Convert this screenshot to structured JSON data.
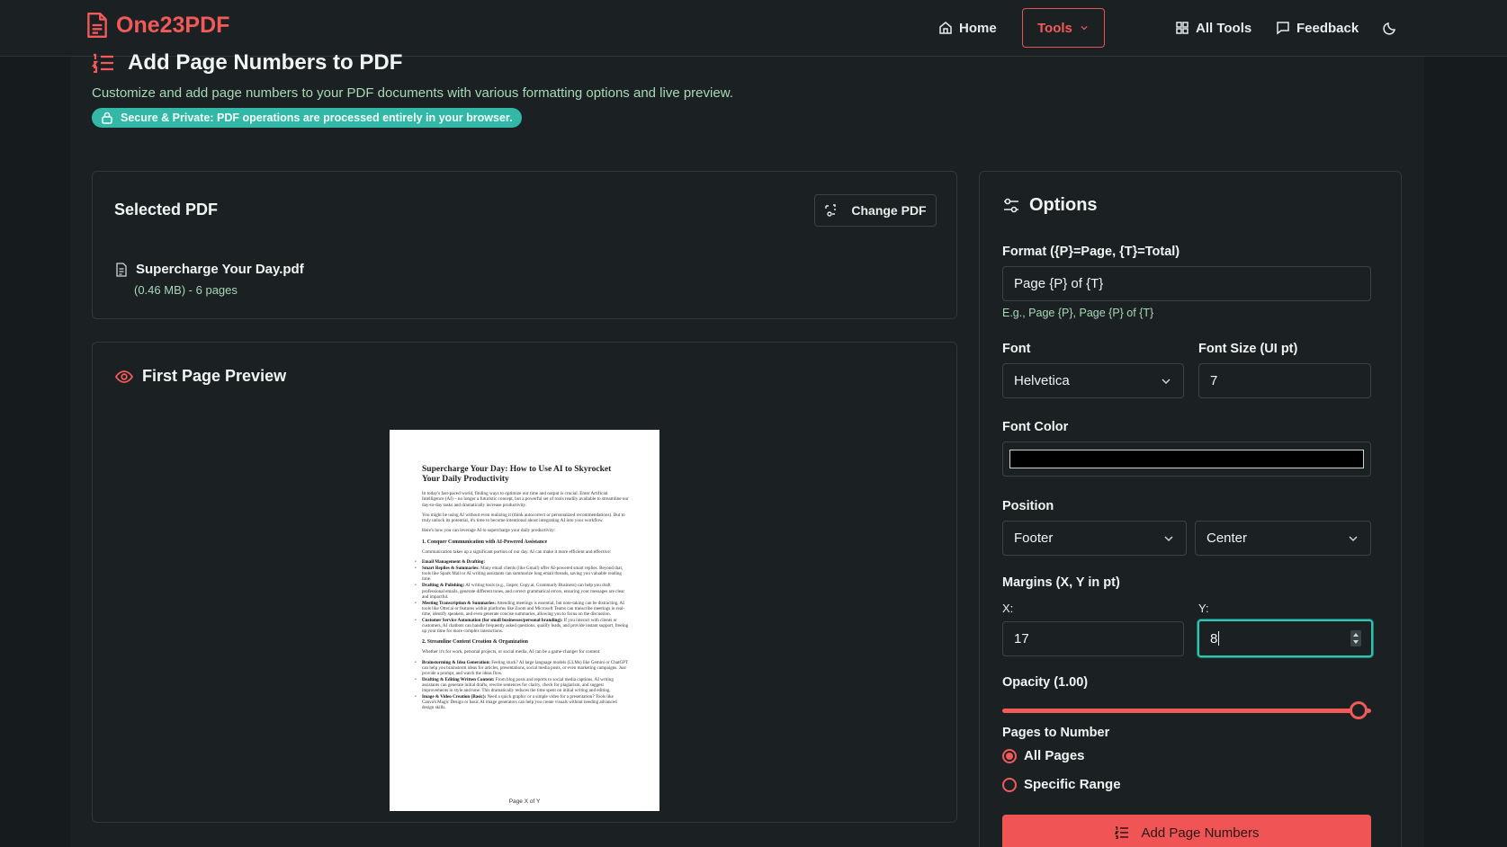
{
  "brand": {
    "name": "One23PDF",
    "color": "#f25a5a"
  },
  "nav": {
    "home": "Home",
    "tools": "Tools",
    "all_tools": "All Tools",
    "feedback": "Feedback",
    "theme_icon": "moon-icon"
  },
  "page": {
    "title": "Add Page Numbers to PDF",
    "subtitle": "Customize and add page numbers to your PDF documents with various formatting options and live preview.",
    "secure_badge": "Secure & Private: PDF operations are processed entirely in your browser."
  },
  "selected_pdf": {
    "title": "Selected PDF",
    "change_button": "Change PDF",
    "file_name": "Supercharge Your Day.pdf",
    "file_meta": "(0.46 MB) - 6 pages"
  },
  "preview": {
    "title": "First Page Preview",
    "doc_title": "Supercharge Your Day: How to Use AI to Skyrocket Your Daily Productivity",
    "para1": "In today's fast-paced world, finding ways to optimize our time and output is crucial. Enter Artificial Intelligence (AI) – no longer a futuristic concept, but a powerful set of tools readily available to streamline our day-to-day tasks and dramatically increase productivity.",
    "para2": "You might be using AI without even realizing it (think autocorrect or personalized recommendations). But to truly unlock its potential, it's time to become intentional about integrating AI into your workflow.",
    "para3": "Here's how you can leverage AI to supercharge your daily productivity:",
    "section1": "1. Conquer Communication with AI-Powered Assistance",
    "section1_intro": "Communication takes up a significant portion of our day. AI can make it more efficient and effective:",
    "s1_items": [
      {
        "bold": "Email Management & Drafting:",
        "text": ""
      },
      {
        "bold": "Smart Replies & Summaries:",
        "text": " Many email clients (like Gmail) offer AI-powered smart replies. Beyond that, tools like Spark Mail or AI writing assistants can summarize long email threads, saving you valuable reading time."
      },
      {
        "bold": "Drafting & Polishing:",
        "text": " AI writing tools (e.g., Jasper, Copy.ai, Grammarly Business) can help you draft professional emails, generate different tones, and correct grammatical errors, ensuring your messages are clear and impactful."
      },
      {
        "bold": "Meeting Transcription & Summaries:",
        "text": " Attending meetings is essential, but note-taking can be distracting. AI tools like Otter.ai or features within platforms like Zoom and Microsoft Teams can transcribe meetings in real-time, identify speakers, and even generate concise summaries, allowing you to focus on the discussion."
      },
      {
        "bold": "Customer Service Automation (for small businesses/personal branding):",
        "text": " If you interact with clients or customers, AI chatbots can handle frequently asked questions, qualify leads, and provide instant support, freeing up your time for more complex interactions."
      }
    ],
    "section2": "2. Streamline Content Creation & Organization",
    "section2_intro": "Whether it's for work, personal projects, or social media, AI can be a game-changer for content:",
    "s2_items": [
      {
        "bold": "Brainstorming & Idea Generation:",
        "text": " Feeling stuck? AI large language models (LLMs) like Gemini or ChatGPT can help you brainstorm ideas for articles, presentations, social media posts, or even marketing campaigns. Just provide a prompt, and watch the ideas flow."
      },
      {
        "bold": "Drafting & Editing Written Content:",
        "text": " From blog posts and reports to social media captions, AI writing assistants can generate initial drafts, rewrite sentences for clarity, check for plagiarism, and suggest improvements in style and tone. This dramatically reduces the time spent on initial writing and editing."
      },
      {
        "bold": "Image & Video Creation (Basic):",
        "text": " Need a quick graphic or a simple video for a presentation? Tools like Canva's Magic Design or basic AI image generators can help you create visuals without needing advanced design skills."
      }
    ],
    "footer_text": "Page X of Y"
  },
  "options": {
    "title": "Options",
    "format_label": "Format ({P}=Page, {T}=Total)",
    "format_value": "Page {P} of {T}",
    "format_hint": "E.g., Page {P}, Page {P} of {T}",
    "font_label": "Font",
    "font_value": "Helvetica",
    "font_size_label": "Font Size (UI pt)",
    "font_size_value": "7",
    "font_color_label": "Font Color",
    "font_color_value": "#000000",
    "position_label": "Position",
    "position_vertical": "Footer",
    "position_horizontal": "Center",
    "margins_label": "Margins (X, Y in pt)",
    "margin_x_label": "X:",
    "margin_x_value": "17",
    "margin_y_label": "Y:",
    "margin_y_value": "8",
    "opacity_label": "Opacity (1.00)",
    "opacity_value": 1.0,
    "pages_label": "Pages to Number",
    "pages_all": "All Pages",
    "pages_range": "Specific Range",
    "submit": "Add Page Numbers"
  }
}
